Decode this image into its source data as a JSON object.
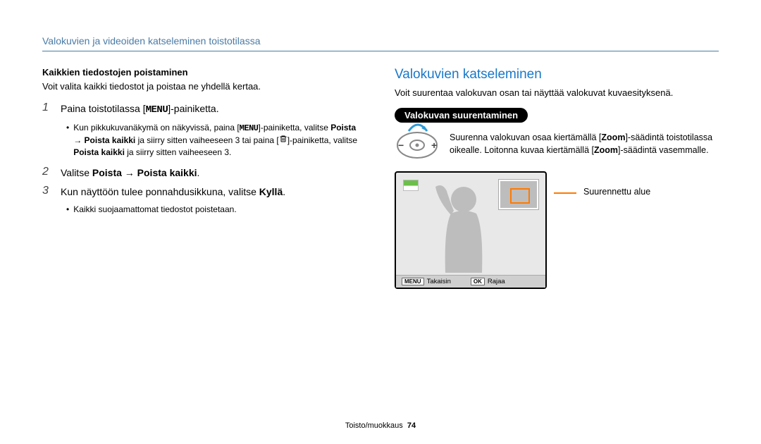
{
  "header": "Valokuvien ja videoiden katseleminen toistotilassa",
  "left": {
    "h1": "Kaikkien tiedostojen poistaminen",
    "p1": "Voit valita kaikki tiedostot ja poistaa ne yhdellä kertaa.",
    "step1": {
      "num": "1",
      "pre": "Paina toistotilassa [",
      "icon": "MENU",
      "post": "]-painiketta."
    },
    "bullet1": {
      "a": "Kun pikkukuvanäkymä on näkyvissä, paina [",
      "icon1": "MENU",
      "b": "]-painiketta, valitse ",
      "b2a": "Poista",
      "arrow": " → ",
      "b2b": "Poista kaikki",
      "c": " ja siirry sitten vaiheeseen 3 tai paina [",
      "d": "]-painiketta, valitse ",
      "e": "Poista kaikki",
      "f": " ja siirry sitten vaiheeseen 3."
    },
    "step2": {
      "num": "2",
      "pre": "Valitse ",
      "b1": "Poista",
      "arrow": " → ",
      "b2": "Poista kaikki",
      "post": "."
    },
    "step3": {
      "num": "3",
      "pre": "Kun näyttöön tulee ponnahdusikkuna, valitse ",
      "b": "Kyllä",
      "post": "."
    },
    "bullet2": "Kaikki suojaamattomat tiedostot poistetaan."
  },
  "right": {
    "title": "Valokuvien katseleminen",
    "intro": "Voit suurentaa valokuvan osan tai näyttää valokuvat kuvaesityksenä.",
    "pill": "Valokuvan suurentaminen",
    "zoom": {
      "a": "Suurenna valokuvan osaa kiertämällä [",
      "z1": "Zoom",
      "b": "]-säädintä toistotilassa oikealle. Loitonna kuvaa kiertämällä [",
      "z2": "Zoom",
      "c": "]-säädintä vasemmalle."
    },
    "screen": {
      "menu_key": "MENU",
      "back": "Takaisin",
      "ok_key": "OK",
      "crop": "Rajaa"
    },
    "callout": "Suurennettu alue"
  },
  "footer": {
    "label": "Toisto/muokkaus",
    "page": "74"
  }
}
